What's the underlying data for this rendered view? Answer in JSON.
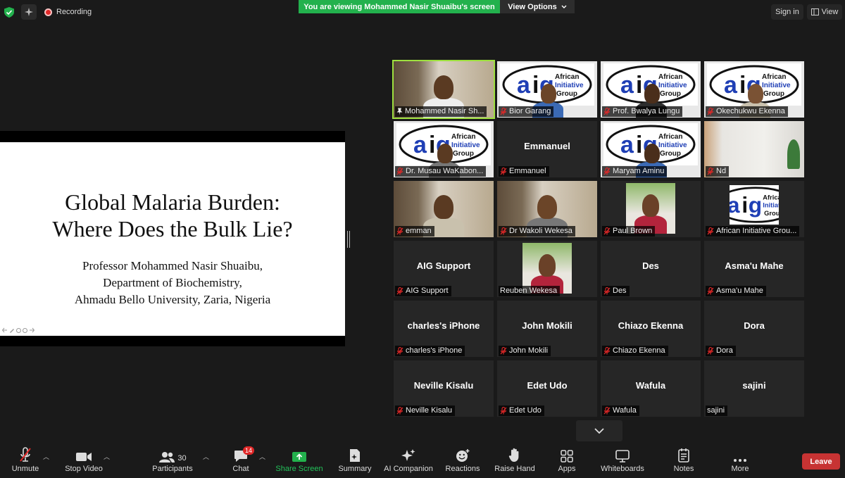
{
  "topbar": {
    "recording_label": "Recording",
    "banner": "You are viewing Mohammed Nasir Shuaibu's screen",
    "view_options": "View Options",
    "sign_in": "Sign in",
    "view": "View"
  },
  "slide": {
    "title_line1": "Global Malaria Burden:",
    "title_line2": "Where Does the Bulk Lie?",
    "body_line1": "Professor Mohammed Nasir Shuaibu,",
    "body_line2": "Department of Biochemistry,",
    "body_line3": "Ahmadu Bello University, Zaria, Nigeria"
  },
  "participants": [
    {
      "label": "Mohammed Nasir Sh...",
      "name": "",
      "video": "camera"
    },
    {
      "label": "Bior Garang",
      "name": "",
      "video": "aig"
    },
    {
      "label": "Prof. Bwalya Lungu",
      "name": "",
      "video": "aig"
    },
    {
      "label": "Okechukwu Ekenna",
      "name": "",
      "video": "aig"
    },
    {
      "label": "Dr. Musau WaKabon...",
      "name": "",
      "video": "aig"
    },
    {
      "label": "Emmanuel",
      "name": "Emmanuel",
      "video": "none"
    },
    {
      "label": "Maryam Aminu",
      "name": "",
      "video": "aig"
    },
    {
      "label": "Nd",
      "name": "",
      "video": "room"
    },
    {
      "label": "emman",
      "name": "",
      "video": "camera"
    },
    {
      "label": "Dr Wakoli Wekesa",
      "name": "",
      "video": "camera"
    },
    {
      "label": "Paul Brown",
      "name": "",
      "video": "photo"
    },
    {
      "label": "African Initiative Grou...",
      "name": "",
      "video": "aig-small"
    },
    {
      "label": "AIG Support",
      "name": "AIG Support",
      "video": "none"
    },
    {
      "label": "Reuben Wekesa",
      "name": "",
      "video": "photo"
    },
    {
      "label": "Des",
      "name": "Des",
      "video": "none"
    },
    {
      "label": "Asma'u Mahe",
      "name": "Asma'u Mahe",
      "video": "none"
    },
    {
      "label": "charles's iPhone",
      "name": "charles's iPhone",
      "video": "none"
    },
    {
      "label": "John Mokili",
      "name": "John Mokili",
      "video": "none"
    },
    {
      "label": "Chiazo Ekenna",
      "name": "Chiazo Ekenna",
      "video": "none"
    },
    {
      "label": "Dora",
      "name": "Dora",
      "video": "none"
    },
    {
      "label": "Neville  Kisalu",
      "name": "Neville  Kisalu",
      "video": "none"
    },
    {
      "label": "Edet Udo",
      "name": "Edet Udo",
      "video": "none"
    },
    {
      "label": "Wafula",
      "name": "Wafula",
      "video": "none"
    },
    {
      "label": "sajini",
      "name": "sajini",
      "video": "none"
    }
  ],
  "aig_logo": {
    "letters": "aig",
    "line1": "African",
    "line2": "Initiative",
    "line3": "Group"
  },
  "toolbar": {
    "unmute": "Unmute",
    "stop_video": "Stop Video",
    "participants": "Participants",
    "participants_count": "30",
    "chat": "Chat",
    "chat_badge": "14",
    "share_screen": "Share Screen",
    "summary": "Summary",
    "ai_companion": "AI Companion",
    "reactions": "Reactions",
    "raise_hand": "Raise Hand",
    "apps": "Apps",
    "whiteboards": "Whiteboards",
    "notes": "Notes",
    "more": "More",
    "leave": "Leave"
  },
  "colors": {
    "share_green": "#23b14d",
    "active_outline": "#9ee03f",
    "leave_red": "#c73333",
    "mic_red": "#e02828"
  }
}
